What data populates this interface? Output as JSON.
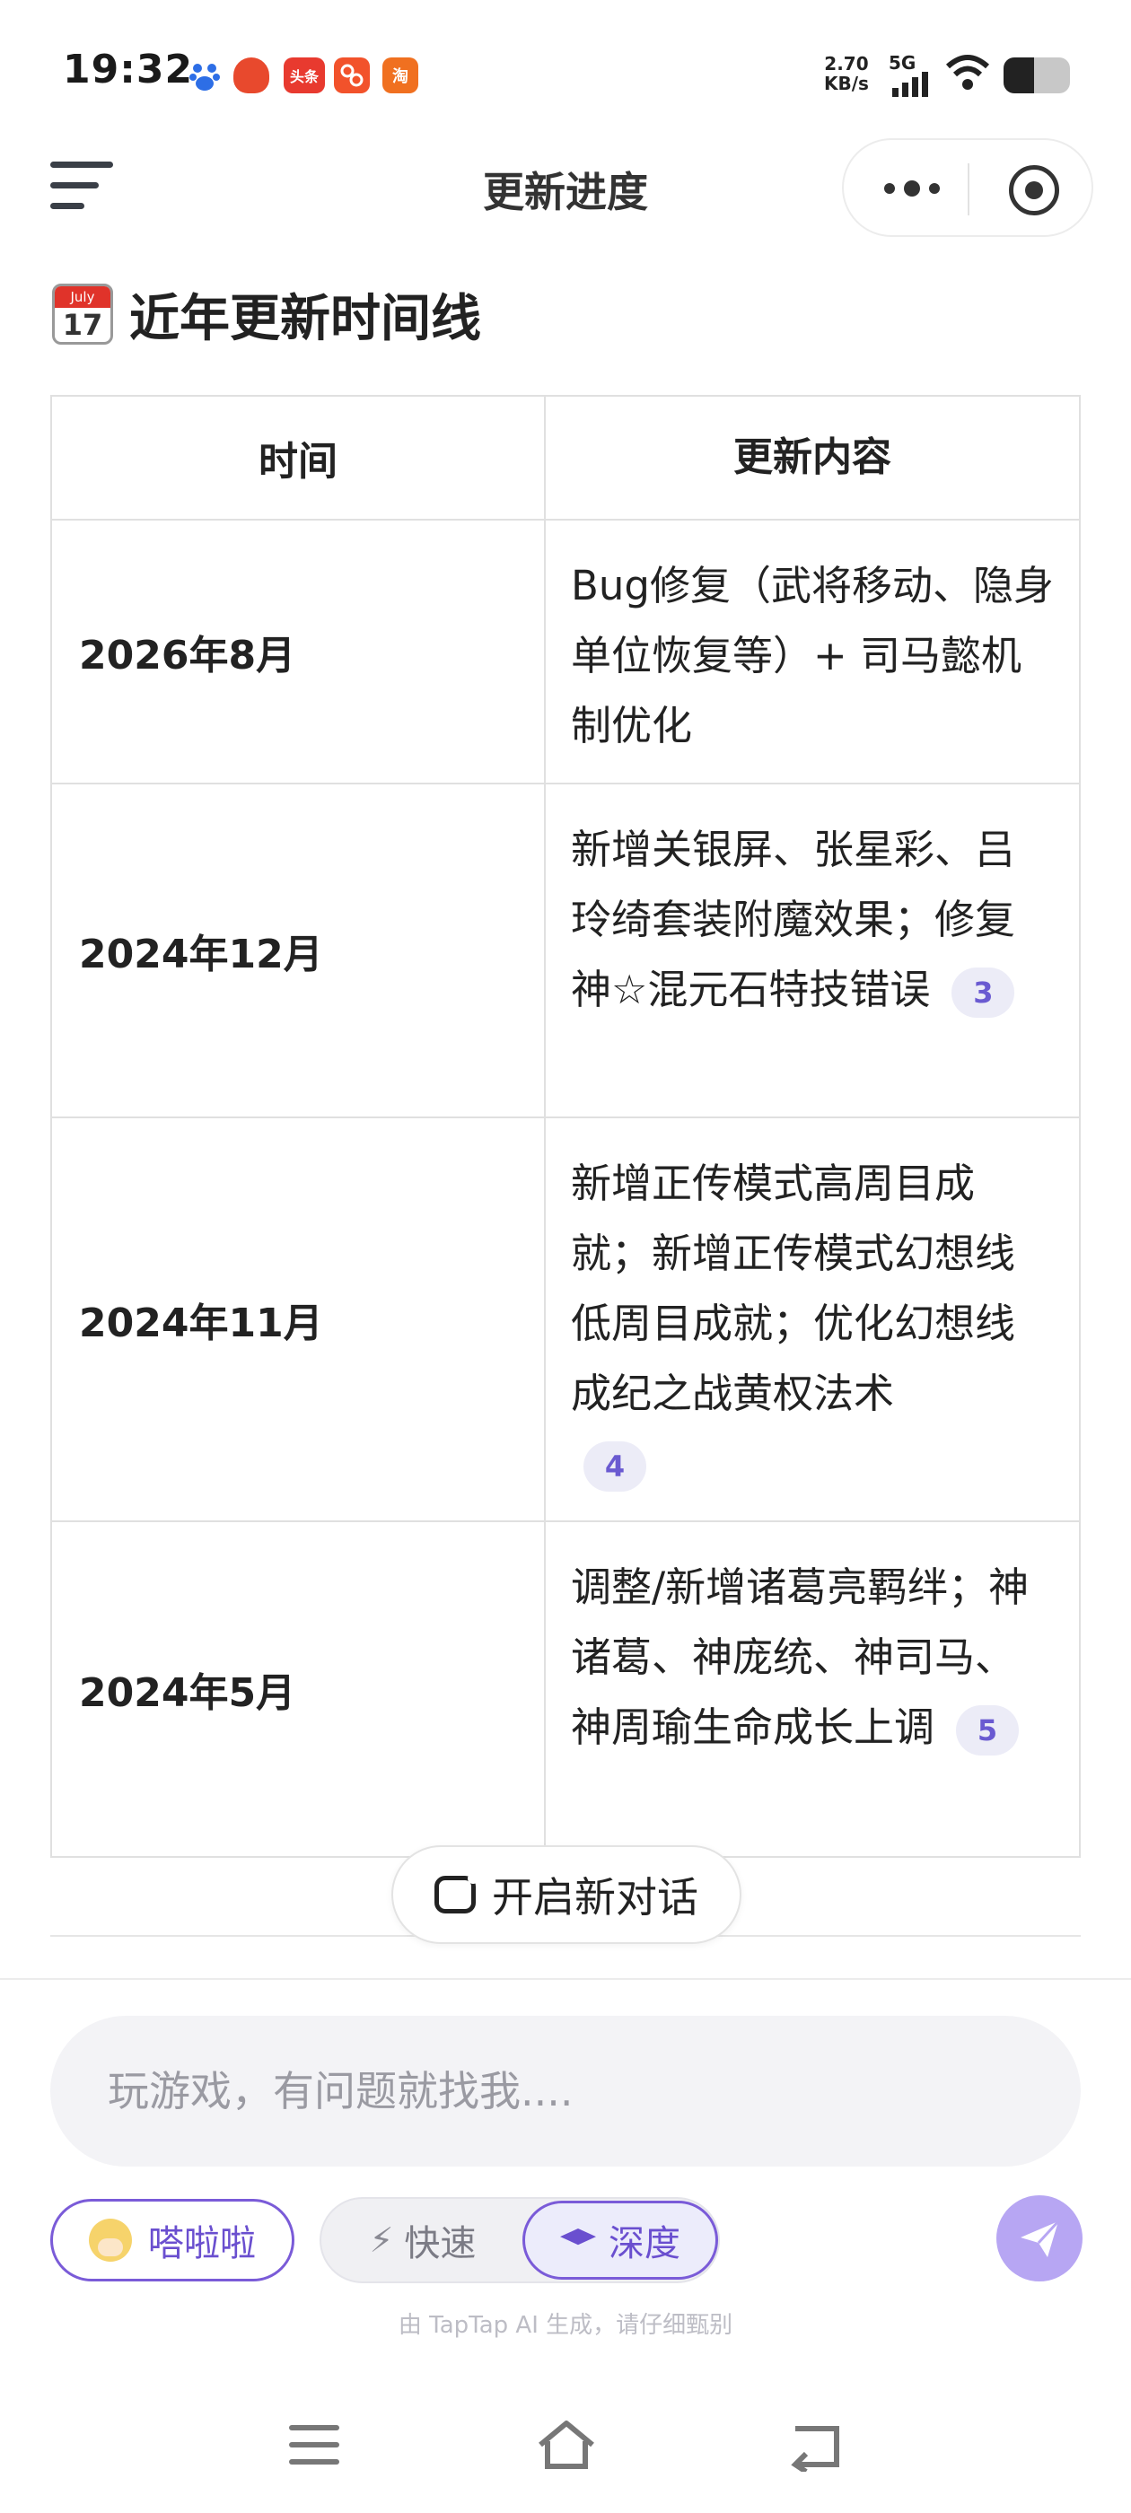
{
  "status_bar": {
    "time": "19:32",
    "notification_badges": [
      "头条",
      "淘"
    ],
    "net_speed_value": "2.70",
    "net_speed_unit": "KB/s",
    "network": "5G",
    "battery_level": 0.46
  },
  "header": {
    "title": "更新进度"
  },
  "section": {
    "heading": "近年更新时间线",
    "calendar_icon": {
      "month": "July",
      "day": "17"
    }
  },
  "table": {
    "columns": [
      "时间",
      "更新内容"
    ],
    "rows": [
      {
        "time": "2026年8月",
        "content": "Bug修复（武将移动、隐身单位恢复等）+ 司马懿机制优化",
        "citation": ""
      },
      {
        "time": "2024年12月",
        "content": "新增关银屏、张星彩、吕玲绮套装附魔效果；修复神☆混元石特技错误",
        "citation": "3"
      },
      {
        "time": "2024年11月",
        "content": "新增正传模式高周目成就；新增正传模式幻想线低周目成就；优化幻想线成纪之战黄权法术",
        "citation": "4"
      },
      {
        "time": "2024年5月",
        "content": "调整/新增诸葛亮羁绊；神诸葛、神庞统、神司马、神周瑜生命成长上调",
        "citation": "5"
      }
    ]
  },
  "new_chat": {
    "label": "开启新对话"
  },
  "input": {
    "placeholder": "玩游戏，有问题就找我...."
  },
  "controls": {
    "agent_label": "嗒啦啦",
    "mode_fast": "快速",
    "mode_deep": "深度",
    "selected_mode": "深度"
  },
  "footnote": "由 TapTap AI 生成，请仔细甄别",
  "colors": {
    "accent": "#6a4fcf",
    "send_button": "#b7a6f3",
    "citation_bg": "#ececf7"
  },
  "icons": [
    "hamburger-menu-icon",
    "more-dots-icon",
    "target-icon",
    "calendar-icon",
    "new-chat-icon",
    "bolt-icon",
    "graduation-cap-icon",
    "send-icon",
    "nav-menu-icon",
    "nav-home-icon",
    "nav-back-icon"
  ]
}
